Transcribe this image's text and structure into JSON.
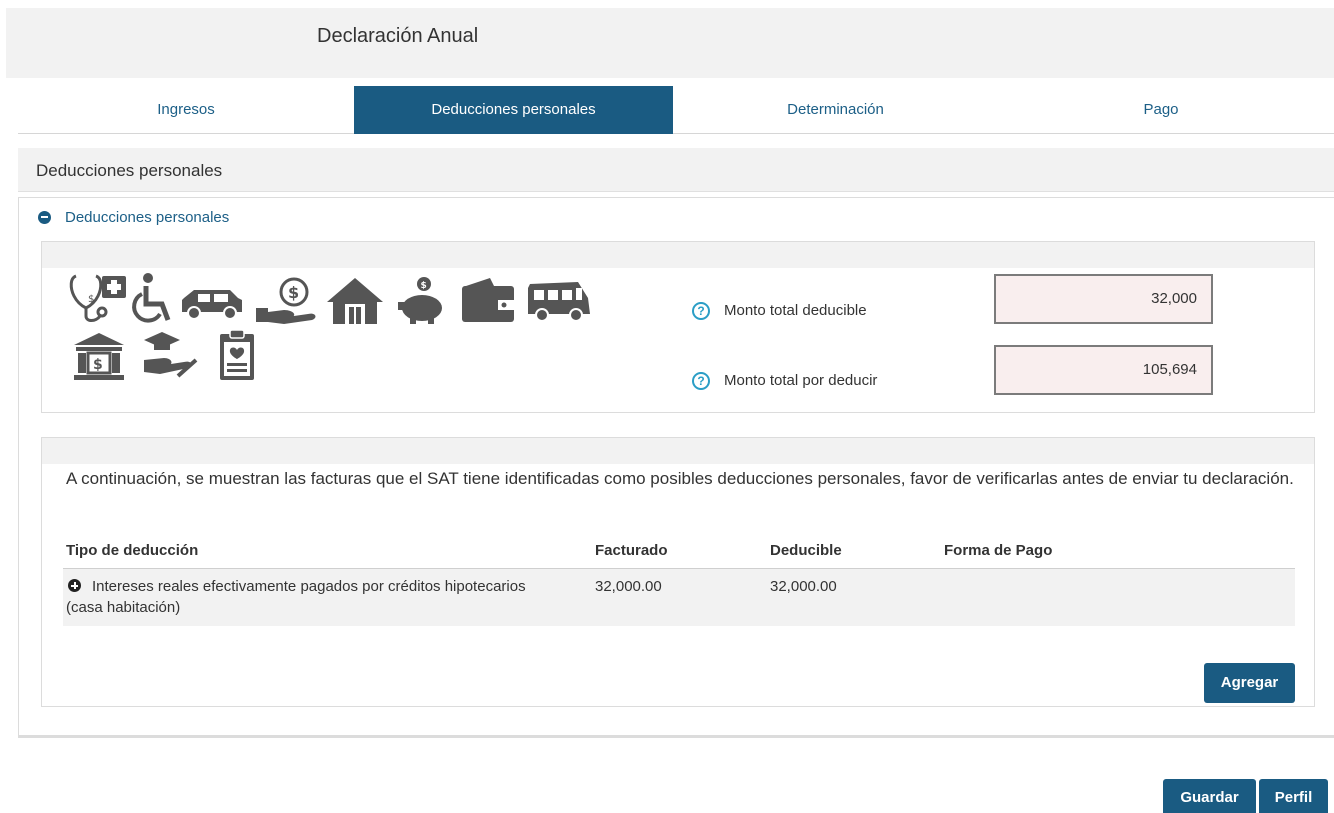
{
  "header": {
    "title": "Declaración Anual"
  },
  "tabs": [
    {
      "label": "Ingresos",
      "active": false
    },
    {
      "label": "Deducciones personales",
      "active": true
    },
    {
      "label": "Determinación",
      "active": false
    },
    {
      "label": "Pago",
      "active": false
    }
  ],
  "section": {
    "title": "Deducciones personales",
    "collapse_label": "Deducciones personales"
  },
  "summary": {
    "icons": [
      "medical-expenses-icon",
      "disability-icon",
      "funeral-car-icon",
      "donation-icon",
      "house-icon",
      "piggy-bank-icon",
      "wallet-icon",
      "school-bus-icon",
      "bank-icon",
      "education-icon",
      "medical-clipboard-icon"
    ],
    "deducible_label": "Monto total deducible",
    "deducible_value": "32,000",
    "por_deducir_label": "Monto total por deducir",
    "por_deducir_value": "105,694"
  },
  "invoices": {
    "intro": "A continuación, se muestran las facturas que el SAT tiene identificadas como posibles deducciones personales, favor de verificarlas antes de enviar tu declaración.",
    "columns": [
      "Tipo de deducción",
      "Facturado",
      "Deducible",
      "Forma de Pago"
    ],
    "rows": [
      {
        "tipo": "Intereses reales efectivamente pagados por créditos hipotecarios (casa habitación)",
        "facturado": "32,000.00",
        "deducible": "32,000.00",
        "forma_pago": ""
      }
    ],
    "add_label": "Agregar"
  },
  "footer": {
    "save_label": "Guardar",
    "profile_label": "Perfil"
  },
  "colors": {
    "primary": "#1a5b82",
    "link": "#1c5f87",
    "help": "#2b9ec6",
    "icon": "#555555"
  }
}
